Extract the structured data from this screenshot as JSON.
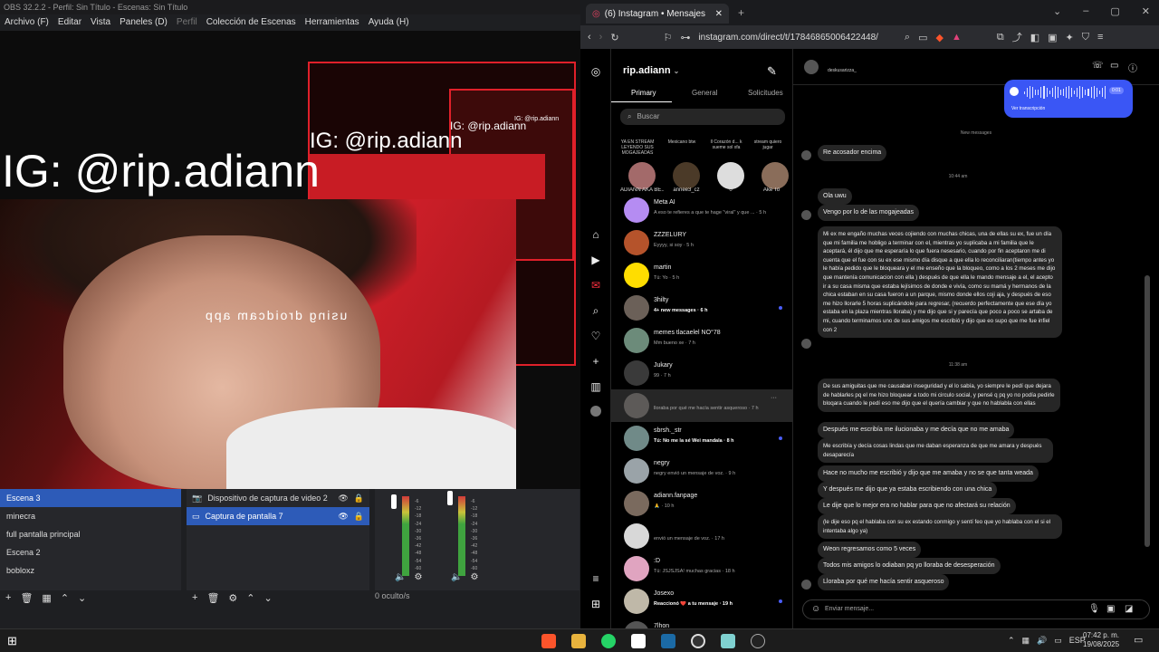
{
  "obs": {
    "title": "OBS 32.2.2 - Perfil: Sin Título - Escenas: Sin Título",
    "menu": [
      "Archivo (F)",
      "Editar",
      "Vista",
      "Paneles (D)",
      "Perfil",
      "Colección de Escenas",
      "Herramientas",
      "Ayuda (H)"
    ],
    "preview_overlay_text": "IG: @rip.adiann",
    "mirrored_text": "using droidcam app",
    "scenes": [
      "Escena 3",
      "minecra",
      "full pantalla principal",
      "Escena 2",
      "bobloxz"
    ],
    "sources": [
      "Dispositivo de captura de video 2",
      "Captura de pantalla 7"
    ],
    "mixer_db": [
      "-6",
      "-12",
      "-18",
      "-24",
      "-30",
      "-36",
      "-42",
      "-48",
      "-54",
      "-60"
    ],
    "status": "0 oculto/s"
  },
  "browser": {
    "tab_title": "(6) Instagram • Mensajes",
    "url": "instagram.com/direct/t/17846865006422448/"
  },
  "instagram": {
    "username": "rip.adiann",
    "filter_tabs": [
      "Primary",
      "General",
      "Solicitudes"
    ],
    "search_placeholder": "Buscar",
    "notes": [
      {
        "bubble": "YA EN STREAM LEYENDO SUS MOGAJEADAS",
        "name": "ADIANN AKA BE..."
      },
      {
        "bubble": "Mexicano btw",
        "name": "annee3_cz"
      },
      {
        "bubble": "Il Corazón d... k sueme sol xfa",
        "name": "0"
      },
      {
        "bubble": "stream quiero jugar",
        "name": "Ake To"
      }
    ],
    "conversations": [
      {
        "name": "Meta AI",
        "preview": "A eso te refieres a que te hage \"viral\" y que ... · 5 h"
      },
      {
        "name": "ZZZELURY",
        "preview": "Eyyyy, si soy · 5 h"
      },
      {
        "name": "martin",
        "preview": "Tú: Yo · 5 h"
      },
      {
        "name": "3hilty",
        "preview": "4+ new messages · 6 h"
      },
      {
        "name": "memes tlacaelel NO°78",
        "preview": "Mm bueno xe · 7 h"
      },
      {
        "name": "Jukary",
        "preview": "99 · 7 h"
      },
      {
        "name": "",
        "preview": "lloraba por qué me hacía sentir asqueroso · 7 h"
      },
      {
        "name": "sbrsh._str",
        "preview": "Tú: No me la sé Wei mandala · 8 h"
      },
      {
        "name": "negry",
        "preview": "negry envió un mensaje de voz. · 9 h"
      },
      {
        "name": "adiann.fanpage",
        "preview": "🙏 · 10 h"
      },
      {
        "name": "",
        "preview": "envió un mensaje de voz. · 17 h"
      },
      {
        "name": ":D",
        "preview": "Tú: JSJSJSA! muchas gracias · 18 h"
      },
      {
        "name": "Josexo",
        "preview": "Reaccionó ❤️ a tu mensaje · 19 h"
      },
      {
        "name": "7lhon",
        "preview": ""
      }
    ],
    "chat": {
      "header_name": "deskusarizza_",
      "voice_time": "0:01",
      "voice_transcript": "Ver transcripción",
      "new_messages_label": "New messages",
      "time_1": "10:44 am",
      "time_2": "11:38 am",
      "messages": [
        "Re acosador encima",
        "Ola uwu",
        "Vengo por lo de las mogajeadas",
        "Mi ex me engaño muchas veces cojiendo con muchas chicas, una de ellas su ex, fue un día que mi familia me hobligo a terminar con el, mientras yo suplicaba a mi familia que le aceptará, él dijo que me esperaría lo que fuera nesesario, cuando por fin aceptaron me di cuenta que el fue con su ex ese mismo día disque a que ella lo reconciliaran(tiempo antes yo le había pedido que le bloqueara y el me enseño que la bloqueo, como a los 2 meses me dijo que mantenía comunicacion con ella ) después de que ella le mando mensaje a el, el acepto ir a su casa misma que estaba lejísimos de donde e vivía, como su mamá y hermanos de la chica estaban en su casa fueron a un parque, mismo donde ellos coji aja, y después de eso me hizo llorarle 5 horas suplicándole para regresar, (recuerdo perfectamente que ese día yo estaba en la plaza mientras lloraba) y me dijo que si y parecía que poco a poco se artaba de mi, cuando terminamos uno de sus amigos me escribió y dijo que eo supo que me fue infiel con 2",
        "De sus amiguitas que me causaban inseguridad y el lo sabía, yo siempre le pedí que dejara de hablarles pq el me hizo bloquear a todo mi circulo social, y pensé q pq yo no podía pedirle bloqara cuando le pedí eso me dijo que el quería cambiar y que no hablabla con ellas",
        "Después me escribía me ilucionaba y me decía que no me amaba",
        "Me escribía y decía cosas lindas que me daban esperanza de que me amara y después desaparecía",
        "Hace no mucho me escribió y dijo que me amaba y no se que tanta weada",
        "Y después me dijo que ya estaba escribiendo con una chica",
        "Le dije que lo mejor era no hablar para que no afectará su relación",
        "(le dije eso pq el hablaba con su ex estando conmigo y sentí feo que yo hablaba con el si el intentaba algo ya)",
        "Weon regresamos como 5 veces",
        "Todos mis amigos lo odiaban pq yo lloraba de desesperación",
        "Lloraba por qué me hacía sentir asqueroso"
      ],
      "input_placeholder": "Enviar mensaje..."
    }
  },
  "taskbar": {
    "lang": "ESP",
    "time": "07:42 p. m.",
    "date": "19/08/2025"
  }
}
